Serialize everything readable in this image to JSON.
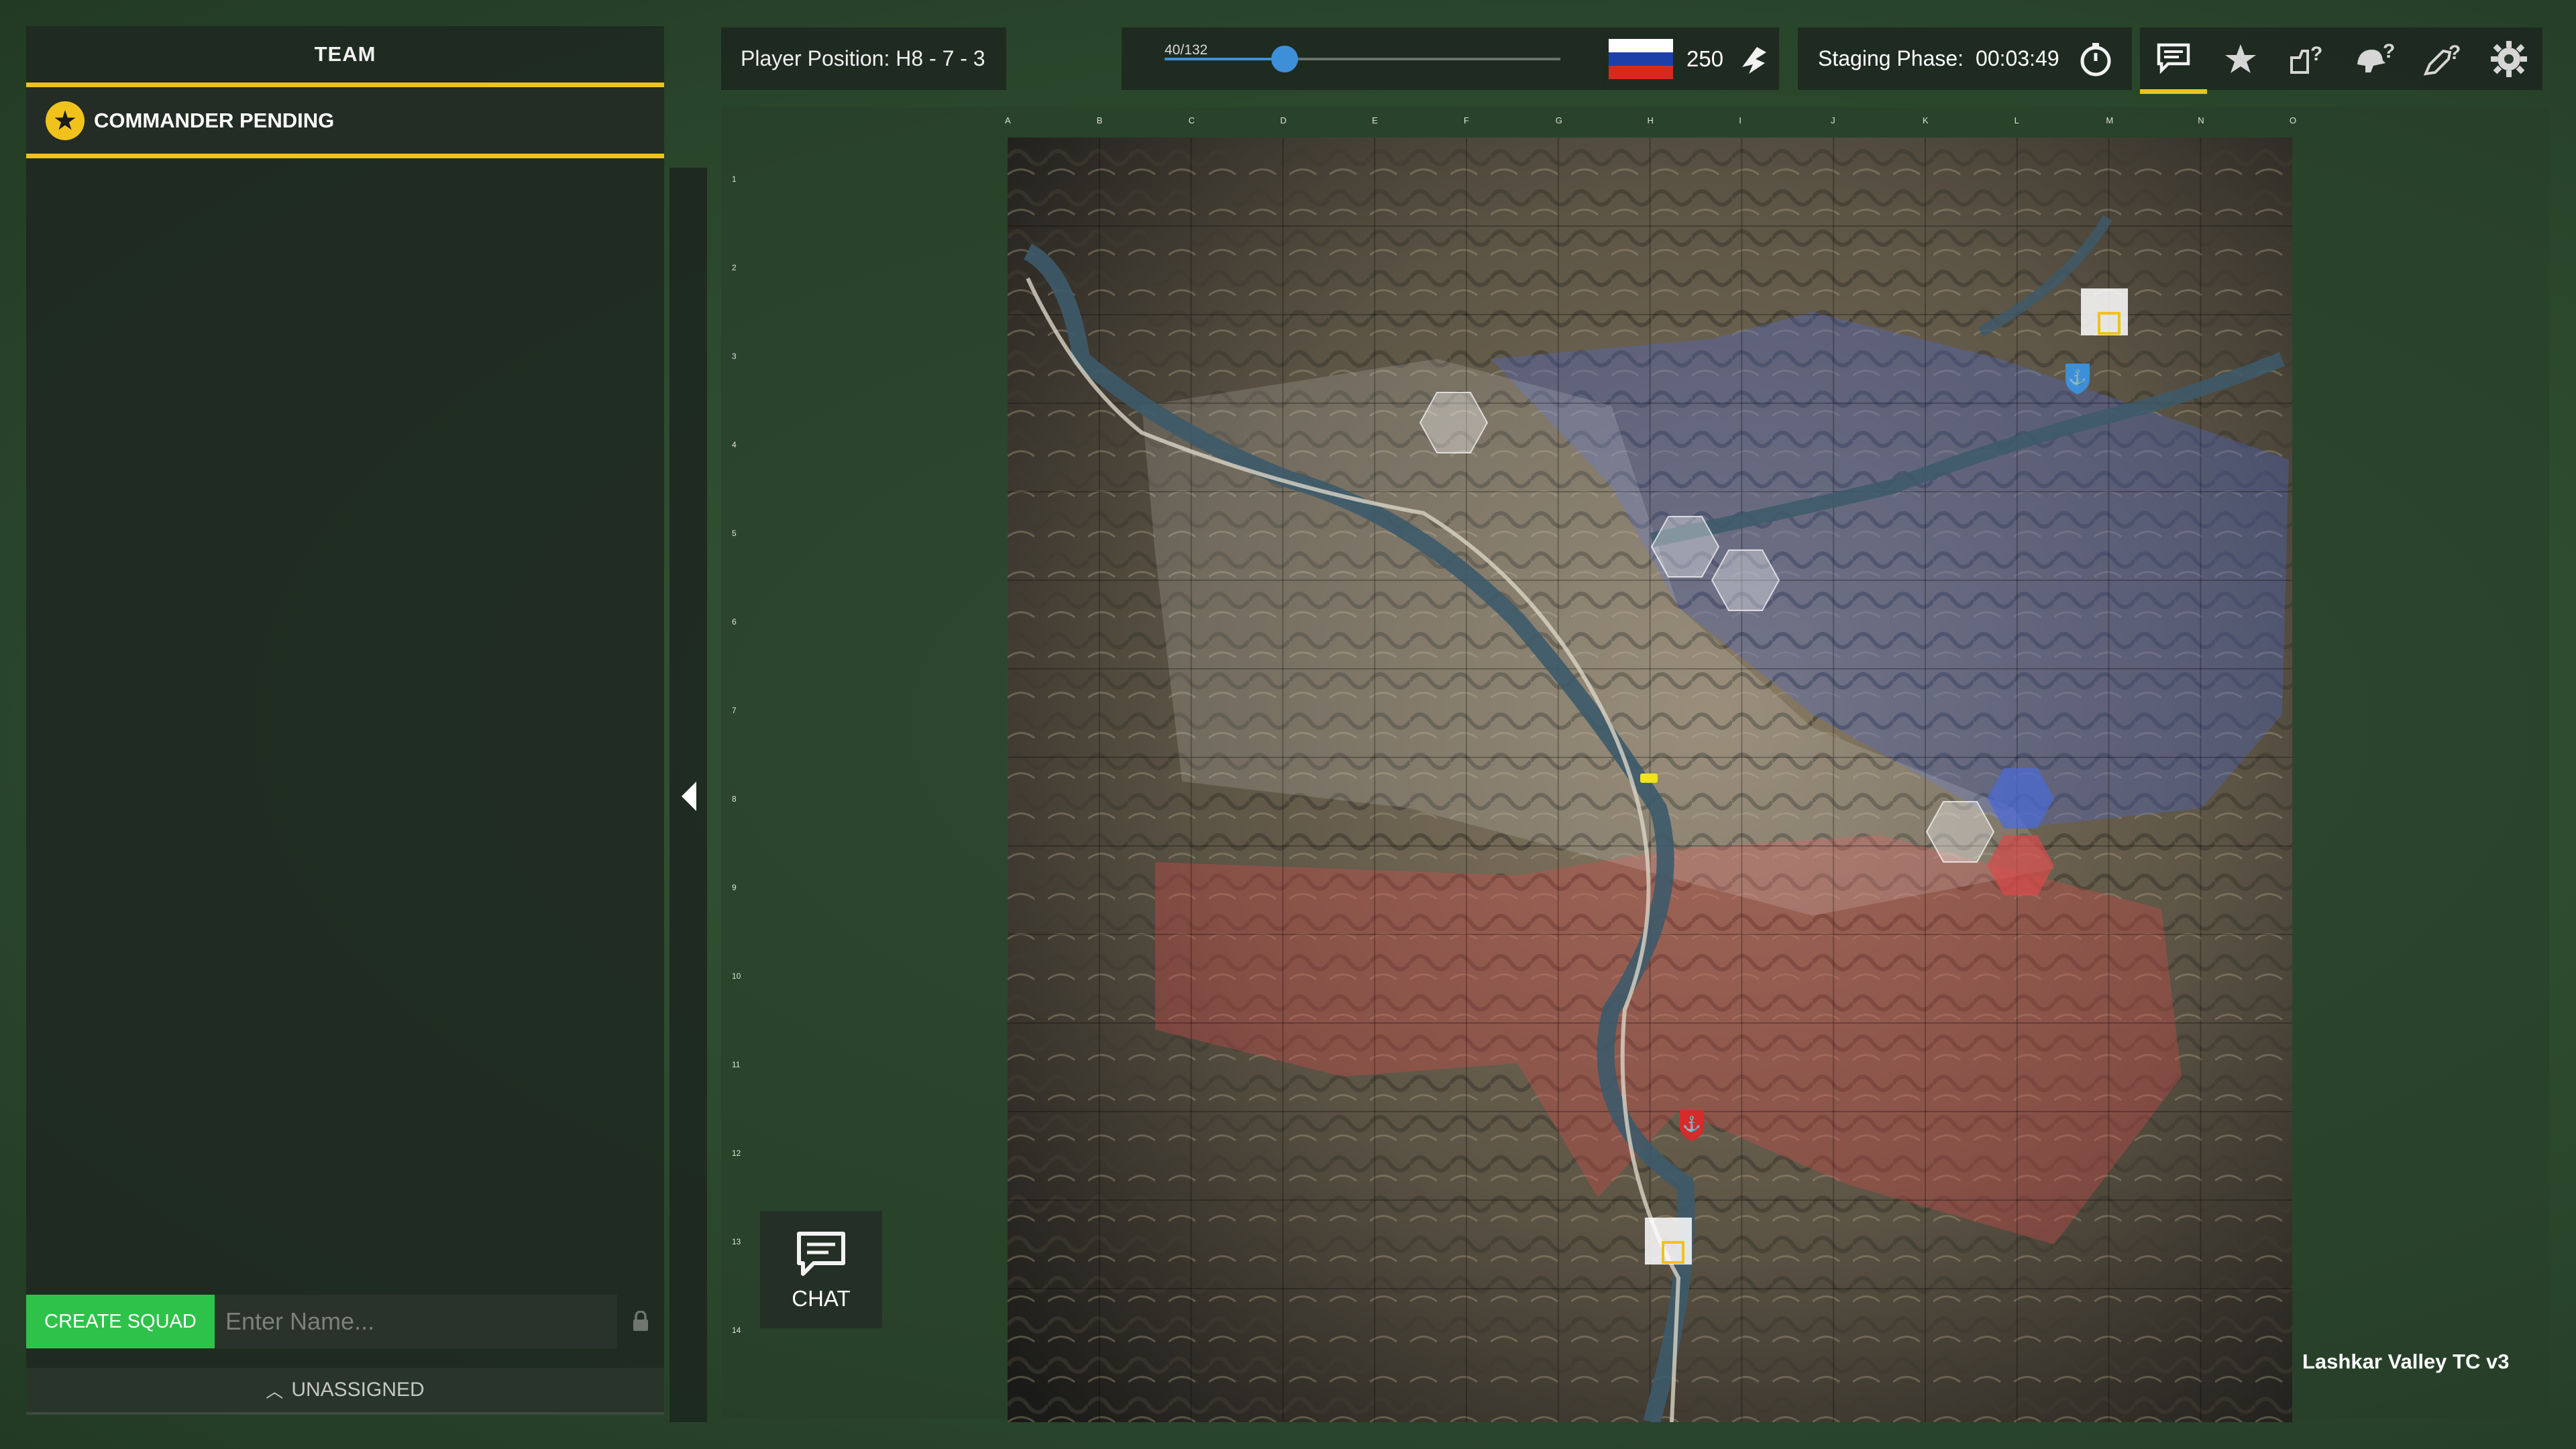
{
  "team_panel": {
    "title": "TEAM",
    "commander_label": "COMMANDER PENDING",
    "create_squad_label": "CREATE SQUAD",
    "name_placeholder": "Enter Name...",
    "unassigned_label": "UNASSIGNED"
  },
  "topbar": {
    "player_position": "Player Position: H8 - 7 - 3",
    "progress_label": "40/132",
    "progress_fraction": 0.303,
    "tickets": "250",
    "staging_label": "Staging Phase:",
    "staging_timer": "00:03:49",
    "icons": [
      "chat-icon",
      "star-icon",
      "vehicle-request-icon",
      "helmet-request-icon",
      "rocket-request-icon",
      "gear-icon"
    ]
  },
  "map": {
    "columns": [
      "A",
      "B",
      "C",
      "D",
      "E",
      "F",
      "G",
      "H",
      "I",
      "J",
      "K",
      "L",
      "M",
      "N",
      "O"
    ],
    "rows": [
      "1",
      "2",
      "3",
      "4",
      "5",
      "6",
      "7",
      "8",
      "9",
      "10",
      "11",
      "12",
      "13",
      "14"
    ],
    "name": "Lashkar Valley TC v3"
  },
  "chat": {
    "label": "CHAT"
  },
  "colors": {
    "accent": "#f0c21b",
    "create_squad": "#2fc24a",
    "blue_team": "#4a6bd8",
    "red_team": "#d84a4a",
    "progress": "#3d8fd8"
  }
}
